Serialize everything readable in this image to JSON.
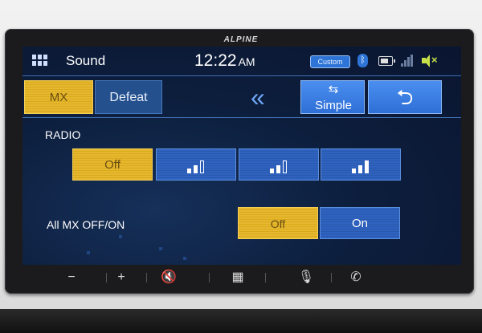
{
  "device": {
    "brand": "ALPINE"
  },
  "statusbar": {
    "title": "Sound",
    "time": "12:22",
    "ampm": "AM",
    "eq_preset": "Custom",
    "icons": [
      "menu-grid-icon",
      "bluetooth-icon",
      "battery-icon",
      "signal-icon",
      "mute-icon"
    ]
  },
  "toolbar": {
    "mx_label": "MX",
    "defeat_label": "Defeat",
    "collapse_icon": "double-chevron-left-icon",
    "simple_label": "Simple",
    "back_icon": "return-arrow-icon"
  },
  "radio": {
    "label": "RADIO",
    "options": [
      {
        "label": "Off",
        "selected": true
      },
      {
        "icon": "level-1-bars-icon",
        "selected": false
      },
      {
        "icon": "level-2-bars-icon",
        "selected": false
      },
      {
        "icon": "level-3-bars-icon",
        "selected": false
      }
    ]
  },
  "all_mx": {
    "label": "All MX OFF/ON",
    "off_label": "Off",
    "on_label": "On",
    "selected": "Off"
  },
  "hardkeys": [
    "minus-icon",
    "plus-icon",
    "mute-speaker-icon",
    "home-grid-icon",
    "microphone-icon",
    "phone-icon"
  ],
  "colors": {
    "selected": "#e6b830",
    "button": "#2f63c0",
    "accent": "#4b8ff0",
    "screen_bg": "#0d1f3e"
  }
}
